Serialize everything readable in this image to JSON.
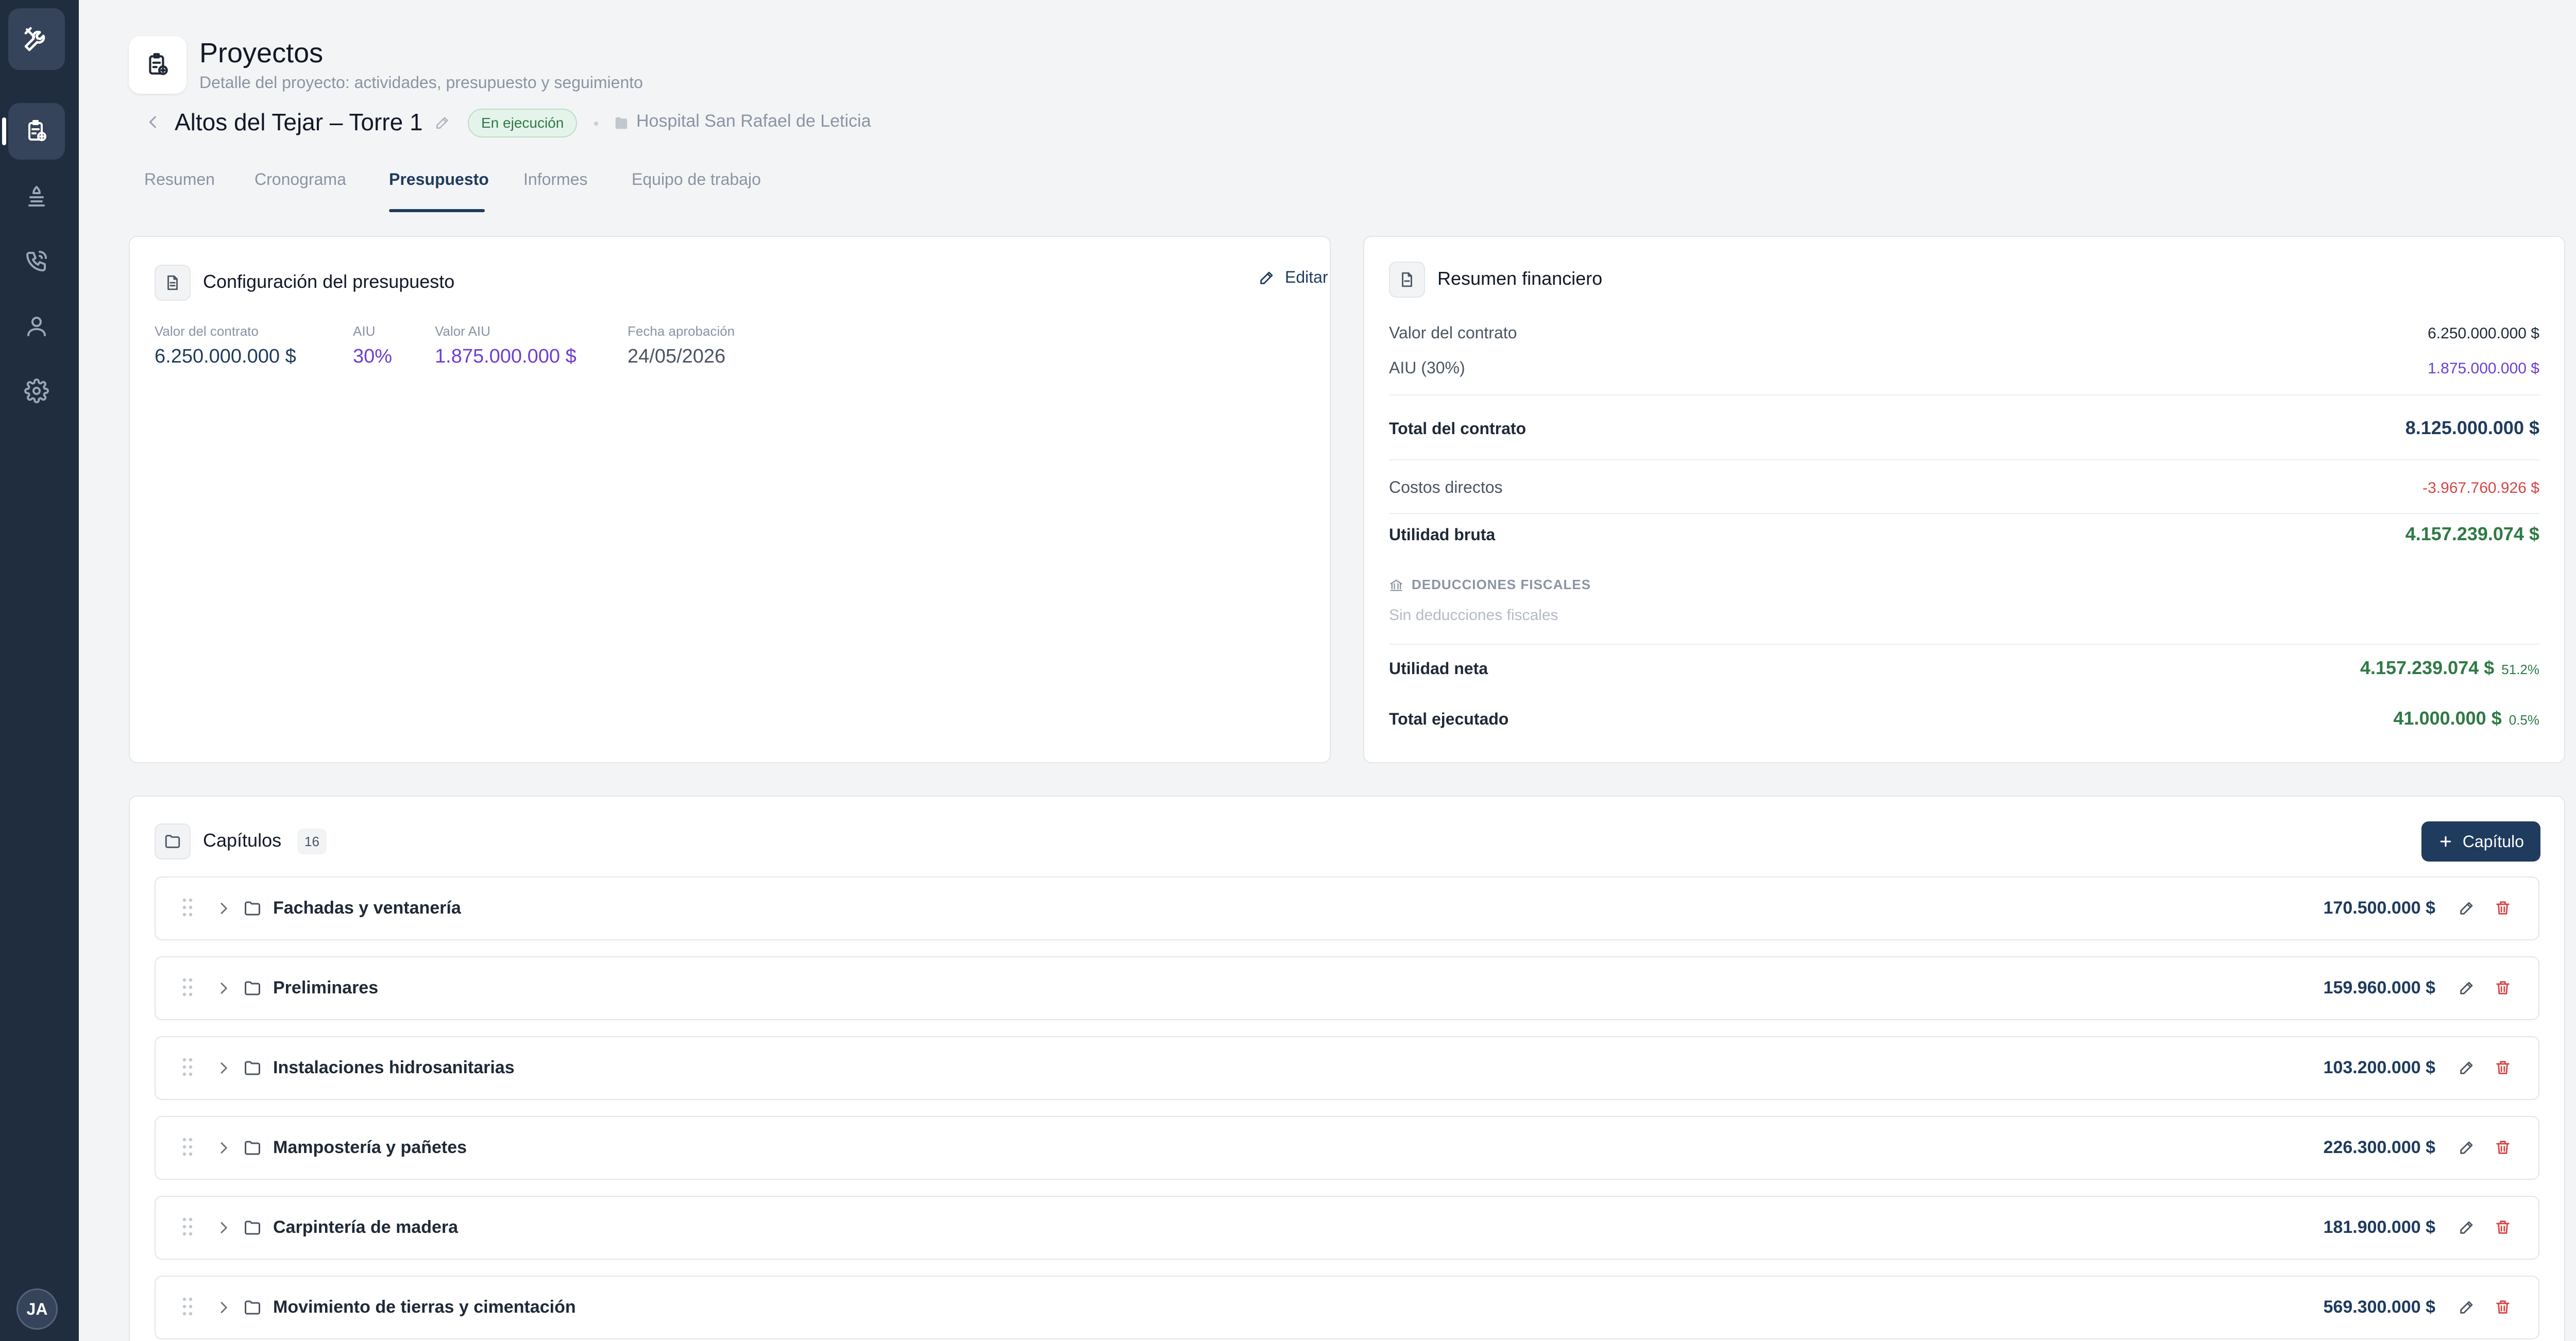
{
  "app": {
    "user_initials": "JA"
  },
  "sidebar": {
    "items": [
      "logo-icon",
      "projects-icon",
      "equipment-icon",
      "calls-icon",
      "user-icon",
      "settings-icon"
    ]
  },
  "header": {
    "title": "Proyectos",
    "subtitle": "Detalle del proyecto: actividades, presupuesto y seguimiento",
    "project_name": "Altos del Tejar – Torre 1",
    "status": "En ejecución",
    "client": "Hospital San Rafael de Leticia"
  },
  "tabs": [
    {
      "label": "Resumen",
      "active": false
    },
    {
      "label": "Cronograma",
      "active": false
    },
    {
      "label": "Presupuesto",
      "active": true
    },
    {
      "label": "Informes",
      "active": false
    },
    {
      "label": "Equipo de trabajo",
      "active": false
    }
  ],
  "budget_config": {
    "title": "Configuración del presupuesto",
    "edit_label": "Editar",
    "fields": [
      {
        "label": "Valor del contrato",
        "value": "6.250.000.000 $"
      },
      {
        "label": "AIU",
        "value": "30%"
      },
      {
        "label": "Valor AIU",
        "value": "1.875.000.000 $"
      },
      {
        "label": "Fecha aprobación",
        "value": "24/05/2026"
      }
    ]
  },
  "financial_summary": {
    "title": "Resumen financiero",
    "contract_value_label": "Valor del contrato",
    "contract_value": "6.250.000.000 $",
    "aiu_label": "AIU (30%)",
    "aiu_value": "1.875.000.000 $",
    "total_contract_label": "Total del contrato",
    "total_contract": "8.125.000.000 $",
    "direct_costs_label": "Costos directos",
    "direct_costs": "-3.967.760.926 $",
    "gross_profit_label": "Utilidad bruta",
    "gross_profit": "4.157.239.074 $",
    "deductions_title": "DEDUCCIONES FISCALES",
    "deductions_empty": "Sin deducciones fiscales",
    "net_profit_label": "Utilidad neta",
    "net_profit": "4.157.239.074 $",
    "net_profit_pct": "51.2%",
    "executed_label": "Total ejecutado",
    "executed": "41.000.000 $",
    "executed_pct": "0.5%"
  },
  "chapters": {
    "title": "Capítulos",
    "count": "16",
    "add_label": "Capítulo",
    "items": [
      {
        "name": "Fachadas y ventanería",
        "value": "170.500.000 $"
      },
      {
        "name": "Preliminares",
        "value": "159.960.000 $"
      },
      {
        "name": "Instalaciones hidrosanitarias",
        "value": "103.200.000 $"
      },
      {
        "name": "Mampostería y pañetes",
        "value": "226.300.000 $"
      },
      {
        "name": "Carpintería de madera",
        "value": "181.900.000 $"
      },
      {
        "name": "Movimiento de tierras y cimentación",
        "value": "569.300.000 $"
      }
    ]
  }
}
